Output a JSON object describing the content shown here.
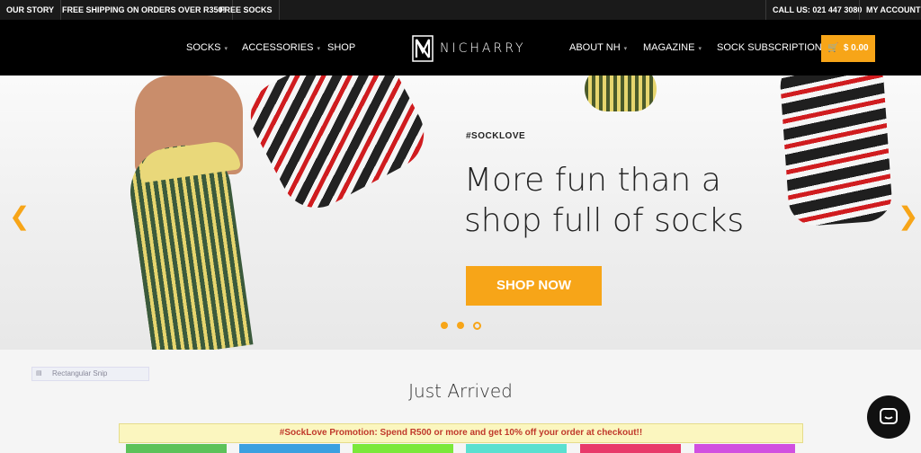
{
  "topbar": {
    "left": [
      "OUR STORY",
      "FREE SHIPPING ON ORDERS OVER R350!",
      "FREE SOCKS"
    ],
    "call": "CALL US: 021 447 3080",
    "account": "MY ACCOUNT"
  },
  "nav": {
    "socks": "SOCKS",
    "accessories": "ACCESSORIES",
    "shop": "SHOP",
    "about": "ABOUT NH",
    "magazine": "MAGAZINE",
    "subscriptions": "SOCK SUBSCRIPTIONS",
    "logo": "NICHARRY",
    "cart_total": "$ 0.00"
  },
  "hero": {
    "tag": "#SOCKLOVE",
    "title_line1": "More fun than a",
    "title_line2": "shop full of socks",
    "button": "SHOP NOW",
    "slide_count": 3,
    "active_slide": 3
  },
  "section": {
    "broken_image_alt": "Rectangular Snip",
    "heading": "Just Arrived",
    "promo": "#SockLove Promotion: Spend R500 or more and get 10% off your order at checkout!!"
  },
  "colors": {
    "accent": "#f7a518",
    "topbar_bg": "#1a1a1a",
    "nav_bg": "#000000",
    "promo_text": "#c0392b",
    "thumbs": [
      "#5cc25a",
      "#3ba0e0",
      "#7be83a",
      "#5ae0d0",
      "#e83a6a",
      "#d14fe0"
    ]
  },
  "icons": {
    "prev": "chevron-left-icon",
    "next": "chevron-right-icon",
    "cart": "cart-icon",
    "chat": "chat-bubble-icon"
  }
}
